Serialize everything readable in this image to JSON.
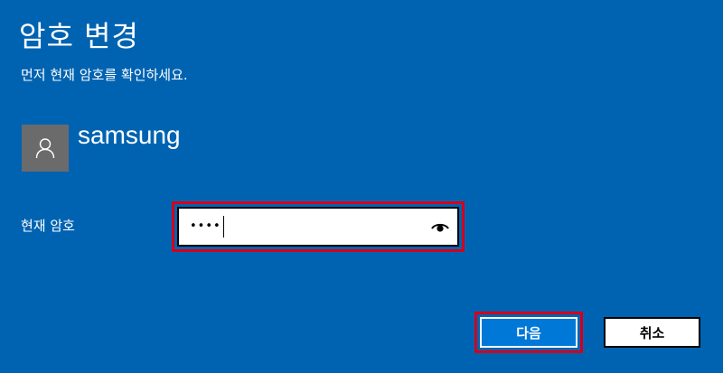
{
  "dialog": {
    "title": "암호 변경",
    "subtitle": "먼저 현재 암호를 확인하세요."
  },
  "user": {
    "avatar_icon": "person-icon",
    "name": "samsung"
  },
  "password_field": {
    "label": "현재 암호",
    "value": "••••",
    "reveal_icon": "eye-icon"
  },
  "buttons": {
    "next_label": "다음",
    "cancel_label": "취소"
  },
  "colors": {
    "background": "#0063b1",
    "highlight": "#d3001b",
    "primary_button": "#0078d7",
    "avatar": "#6b6b6b"
  }
}
